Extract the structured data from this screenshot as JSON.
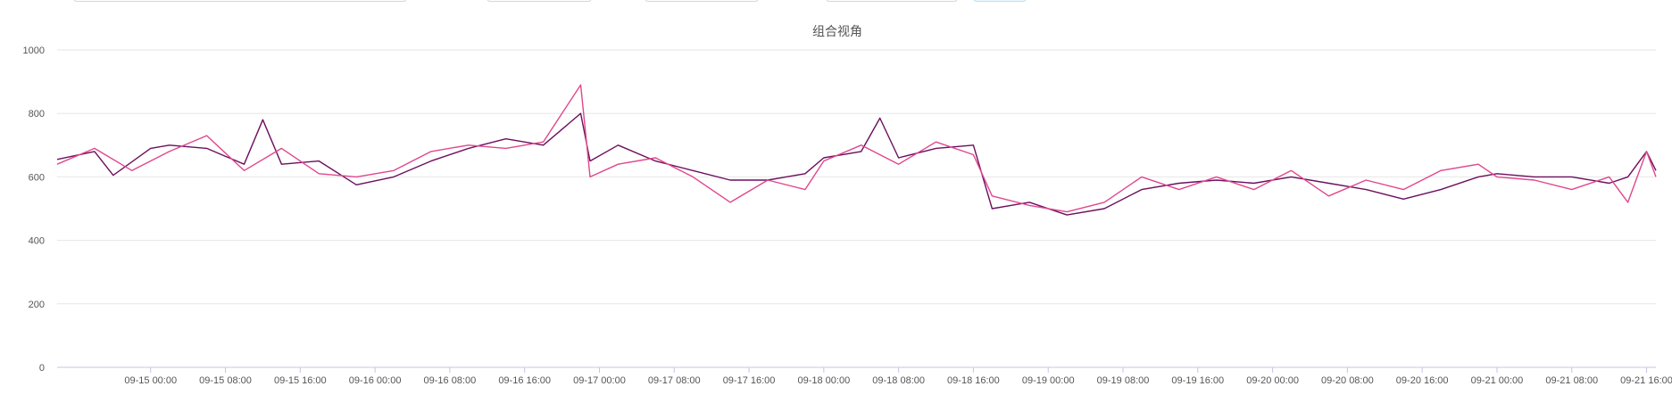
{
  "chart_data": {
    "type": "line",
    "title": "组合视角",
    "xlabel": "",
    "ylabel": "",
    "x_range": [
      "2024-09-14 14:00",
      "2024-09-21 17:00"
    ],
    "ylim": [
      0,
      1000
    ],
    "yticks": [
      0,
      200,
      400,
      600,
      800,
      1000
    ],
    "xticks": [
      {
        "t": "2024-09-15 00:00",
        "label": "09-15 00:00"
      },
      {
        "t": "2024-09-15 08:00",
        "label": "09-15 08:00"
      },
      {
        "t": "2024-09-15 16:00",
        "label": "09-15 16:00"
      },
      {
        "t": "2024-09-16 00:00",
        "label": "09-16 00:00"
      },
      {
        "t": "2024-09-16 08:00",
        "label": "09-16 08:00"
      },
      {
        "t": "2024-09-16 16:00",
        "label": "09-16 16:00"
      },
      {
        "t": "2024-09-17 00:00",
        "label": "09-17 00:00"
      },
      {
        "t": "2024-09-17 08:00",
        "label": "09-17 08:00"
      },
      {
        "t": "2024-09-17 16:00",
        "label": "09-17 16:00"
      },
      {
        "t": "2024-09-18 00:00",
        "label": "09-18 00:00"
      },
      {
        "t": "2024-09-18 08:00",
        "label": "09-18 08:00"
      },
      {
        "t": "2024-09-18 16:00",
        "label": "09-18 16:00"
      },
      {
        "t": "2024-09-19 00:00",
        "label": "09-19 00:00"
      },
      {
        "t": "2024-09-19 08:00",
        "label": "09-19 08:00"
      },
      {
        "t": "2024-09-19 16:00",
        "label": "09-19 16:00"
      },
      {
        "t": "2024-09-20 00:00",
        "label": "09-20 00:00"
      },
      {
        "t": "2024-09-20 08:00",
        "label": "09-20 08:00"
      },
      {
        "t": "2024-09-20 16:00",
        "label": "09-20 16:00"
      },
      {
        "t": "2024-09-21 00:00",
        "label": "09-21 00:00"
      },
      {
        "t": "2024-09-21 08:00",
        "label": "09-21 08:00"
      },
      {
        "t": "2024-09-21 16:00",
        "label": "09-21 16:00"
      }
    ],
    "grid": true,
    "series": [
      {
        "color": "#6b0f5f",
        "points": [
          [
            "2024-09-14 14:00",
            655
          ],
          [
            "2024-09-14 18:00",
            680
          ],
          [
            "2024-09-14 20:00",
            605
          ],
          [
            "2024-09-15 00:00",
            690
          ],
          [
            "2024-09-15 02:00",
            700
          ],
          [
            "2024-09-15 06:00",
            690
          ],
          [
            "2024-09-15 10:00",
            640
          ],
          [
            "2024-09-15 12:00",
            780
          ],
          [
            "2024-09-15 14:00",
            640
          ],
          [
            "2024-09-15 18:00",
            650
          ],
          [
            "2024-09-15 22:00",
            575
          ],
          [
            "2024-09-16 02:00",
            600
          ],
          [
            "2024-09-16 06:00",
            650
          ],
          [
            "2024-09-16 10:00",
            690
          ],
          [
            "2024-09-16 14:00",
            720
          ],
          [
            "2024-09-16 18:00",
            700
          ],
          [
            "2024-09-16 22:00",
            800
          ],
          [
            "2024-09-16 23:00",
            650
          ],
          [
            "2024-09-17 02:00",
            700
          ],
          [
            "2024-09-17 06:00",
            650
          ],
          [
            "2024-09-17 10:00",
            620
          ],
          [
            "2024-09-17 14:00",
            590
          ],
          [
            "2024-09-17 18:00",
            590
          ],
          [
            "2024-09-17 22:00",
            610
          ],
          [
            "2024-09-18 00:00",
            660
          ],
          [
            "2024-09-18 04:00",
            680
          ],
          [
            "2024-09-18 06:00",
            785
          ],
          [
            "2024-09-18 08:00",
            660
          ],
          [
            "2024-09-18 12:00",
            690
          ],
          [
            "2024-09-18 16:00",
            700
          ],
          [
            "2024-09-18 18:00",
            500
          ],
          [
            "2024-09-18 22:00",
            520
          ],
          [
            "2024-09-19 02:00",
            480
          ],
          [
            "2024-09-19 06:00",
            500
          ],
          [
            "2024-09-19 10:00",
            560
          ],
          [
            "2024-09-19 14:00",
            580
          ],
          [
            "2024-09-19 18:00",
            590
          ],
          [
            "2024-09-19 22:00",
            580
          ],
          [
            "2024-09-20 02:00",
            600
          ],
          [
            "2024-09-20 06:00",
            580
          ],
          [
            "2024-09-20 10:00",
            560
          ],
          [
            "2024-09-20 14:00",
            530
          ],
          [
            "2024-09-20 18:00",
            560
          ],
          [
            "2024-09-20 22:00",
            600
          ],
          [
            "2024-09-21 00:00",
            610
          ],
          [
            "2024-09-21 04:00",
            600
          ],
          [
            "2024-09-21 08:00",
            600
          ],
          [
            "2024-09-21 12:00",
            580
          ],
          [
            "2024-09-21 14:00",
            600
          ],
          [
            "2024-09-21 16:00",
            680
          ],
          [
            "2024-09-21 17:00",
            620
          ]
        ]
      },
      {
        "color": "#e0478c",
        "points": [
          [
            "2024-09-14 14:00",
            640
          ],
          [
            "2024-09-14 18:00",
            690
          ],
          [
            "2024-09-14 22:00",
            620
          ],
          [
            "2024-09-15 02:00",
            680
          ],
          [
            "2024-09-15 06:00",
            730
          ],
          [
            "2024-09-15 10:00",
            620
          ],
          [
            "2024-09-15 14:00",
            690
          ],
          [
            "2024-09-15 18:00",
            610
          ],
          [
            "2024-09-15 22:00",
            600
          ],
          [
            "2024-09-16 02:00",
            620
          ],
          [
            "2024-09-16 06:00",
            680
          ],
          [
            "2024-09-16 10:00",
            700
          ],
          [
            "2024-09-16 14:00",
            690
          ],
          [
            "2024-09-16 18:00",
            710
          ],
          [
            "2024-09-16 22:00",
            890
          ],
          [
            "2024-09-16 23:00",
            600
          ],
          [
            "2024-09-17 02:00",
            640
          ],
          [
            "2024-09-17 06:00",
            660
          ],
          [
            "2024-09-17 10:00",
            600
          ],
          [
            "2024-09-17 14:00",
            520
          ],
          [
            "2024-09-17 18:00",
            590
          ],
          [
            "2024-09-17 22:00",
            560
          ],
          [
            "2024-09-18 00:00",
            650
          ],
          [
            "2024-09-18 04:00",
            700
          ],
          [
            "2024-09-18 08:00",
            640
          ],
          [
            "2024-09-18 12:00",
            710
          ],
          [
            "2024-09-18 16:00",
            670
          ],
          [
            "2024-09-18 18:00",
            540
          ],
          [
            "2024-09-18 22:00",
            510
          ],
          [
            "2024-09-19 02:00",
            490
          ],
          [
            "2024-09-19 06:00",
            520
          ],
          [
            "2024-09-19 10:00",
            600
          ],
          [
            "2024-09-19 14:00",
            560
          ],
          [
            "2024-09-19 18:00",
            600
          ],
          [
            "2024-09-19 22:00",
            560
          ],
          [
            "2024-09-20 02:00",
            620
          ],
          [
            "2024-09-20 06:00",
            540
          ],
          [
            "2024-09-20 10:00",
            590
          ],
          [
            "2024-09-20 14:00",
            560
          ],
          [
            "2024-09-20 18:00",
            620
          ],
          [
            "2024-09-20 22:00",
            640
          ],
          [
            "2024-09-21 00:00",
            600
          ],
          [
            "2024-09-21 04:00",
            590
          ],
          [
            "2024-09-21 08:00",
            560
          ],
          [
            "2024-09-21 12:00",
            600
          ],
          [
            "2024-09-21 14:00",
            520
          ],
          [
            "2024-09-21 16:00",
            680
          ],
          [
            "2024-09-21 17:00",
            600
          ]
        ]
      }
    ]
  }
}
